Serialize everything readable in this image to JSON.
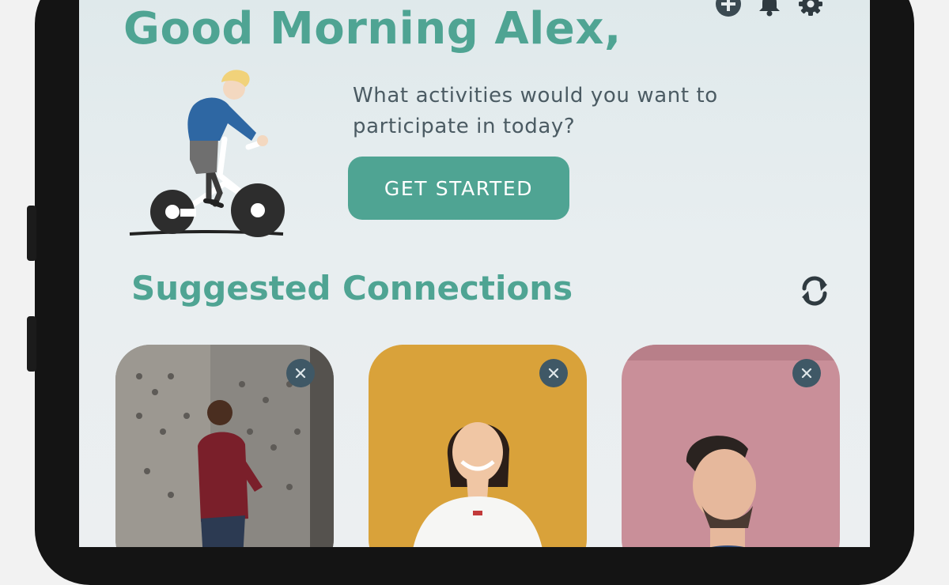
{
  "header": {
    "greeting": "Good Morning Alex,",
    "icons": [
      "add-icon",
      "bell-icon",
      "gear-icon"
    ]
  },
  "hero": {
    "prompt": "What activities would you want to participate in today?",
    "cta_label": "GET STARTED",
    "illustration": "person-cycling"
  },
  "suggestions": {
    "title": "Suggested Connections",
    "refresh_icon": "refresh-icon",
    "cards": [
      {
        "photo": "man-in-red-jacket",
        "dismiss_icon": "close-icon"
      },
      {
        "photo": "smiling-woman-yellow-background",
        "dismiss_icon": "close-icon"
      },
      {
        "photo": "man-pink-background",
        "dismiss_icon": "close-icon"
      }
    ]
  },
  "colors": {
    "brand": "#4fa493",
    "text": "#4b5b63",
    "dismiss_bg": "#3f5866",
    "screen_bg": "#e6ecee"
  }
}
